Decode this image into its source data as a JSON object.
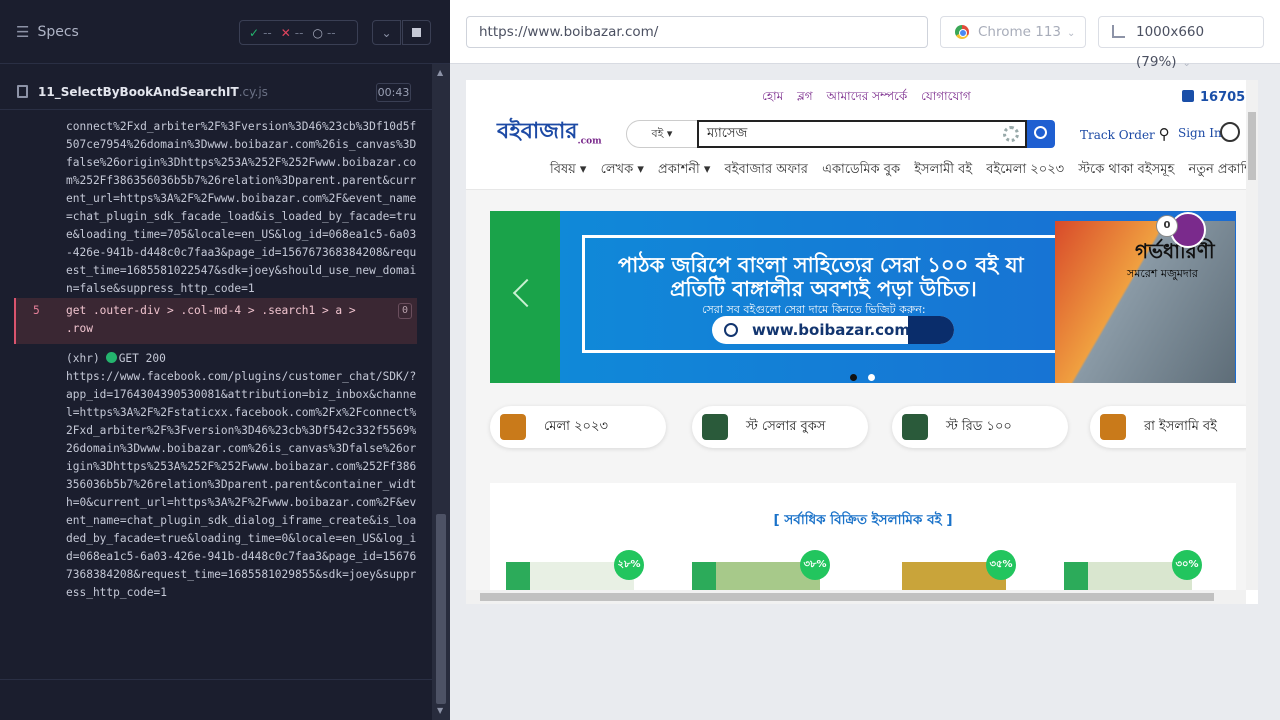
{
  "runner": {
    "specs_label": "Specs",
    "stats": {
      "passed": "--",
      "failed": "--",
      "pending": "--"
    },
    "file": {
      "name": "11_SelectByBookAndSearchIT",
      "ext": ".cy.js",
      "time": "00:43"
    },
    "log_top": "connect%2Fxd_arbiter%2F%3Fversion%3D46%23cb%3Df10d5f507ce7954%26domain%3Dwww.boibazar.com%26is_canvas%3Dfalse%26origin%3Dhttps%253A%252F%252Fwww.boibazar.com%252Ff386356036b5b7%26relation%3Dparent.parent&current_url=https%3A%2F%2Fwww.boibazar.com%2F&event_name=chat_plugin_sdk_facade_load&is_loaded_by_facade=true&loading_time=705&locale=en_US&log_id=068ea1c5-6a03-426e-941b-d448c0c7faa3&page_id=156767368384208&request_time=1685581022547&sdk=joey&should_use_new_domain=false&suppress_http_code=1",
    "command": {
      "num": "5",
      "text": "get  .outer-div > .col-md-4 > .search1 > a > .row",
      "count": "0"
    },
    "xhr": {
      "label": "(xhr)",
      "method": "GET 200",
      "url": "https://www.facebook.com/plugins/customer_chat/SDK/?app_id=1764304390530081&attribution=biz_inbox&channel=https%3A%2F%2Fstaticxx.facebook.com%2Fx%2Fconnect%2Fxd_arbiter%2F%3Fversion%3D46%23cb%3Df542c332f5569%26domain%3Dwww.boibazar.com%26is_canvas%3Dfalse%26origin%3Dhttps%253A%252F%252Fwww.boibazar.com%252Ff386356036b5b7%26relation%3Dparent.parent&container_width=0&current_url=https%3A%2F%2Fwww.boibazar.com%2F&event_name=chat_plugin_sdk_dialog_iframe_create&is_loaded_by_facade=true&loading_time=0&locale=en_US&log_id=068ea1c5-6a03-426e-941b-d448c0c7faa3&page_id=156767368384208&request_time=1685581029855&sdk=joey&suppress_http_code=1"
    }
  },
  "browser_bar": {
    "url": "https://www.boibazar.com/",
    "browser": "Chrome 113",
    "viewport": "1000x660  (79%)"
  },
  "site": {
    "top_links": [
      "হোম",
      "ব্লগ",
      "আমাদের সম্পর্কে",
      "যোগাযোগ"
    ],
    "hotline": "16705",
    "logo": "বইবাজার",
    "logo_sub": ".com",
    "category": "বই",
    "search_value": "ম্যাসেজ",
    "track_order": "Track Order",
    "sign_in": "Sign In",
    "nav": [
      "বিষয় ▾",
      "লেখক ▾",
      "প্রকাশনী ▾",
      "বইবাজার অফার",
      "একাডেমিক বুক",
      "ইসলামী বই",
      "বইমেলা ২০২৩",
      "স্টকে থাকা বইসমূহ",
      "নতুন প্রকাশিত ব"
    ],
    "banner": {
      "line1": "পাঠক জরিপে বাংলা সাহিত্যের সেরা ১০০ বই যা",
      "line2": "প্রতিটি বাঙ্গালীর অবশ্যই পড়া উচিত।",
      "line3": "সেরা সব বইগুলো সেরা দামে কিনতে ভিজিট করুন:",
      "url": "www.boibazar.com",
      "book_title": "গর্ভধারিণী",
      "book_author": "সমরেশ মজুমদার"
    },
    "cart_count": "0",
    "chips": [
      "মেলা ২০২৩",
      "স্ট সেলার বুকস",
      "স্ট রিড ১০০",
      "রা ইসলামি বই"
    ],
    "section_title": "[ সর্বাধিক বিক্রিত ইসলামিক বই ]",
    "discounts": [
      "২৮%",
      "৩৮%",
      "৩৫%",
      "৩০%"
    ]
  }
}
